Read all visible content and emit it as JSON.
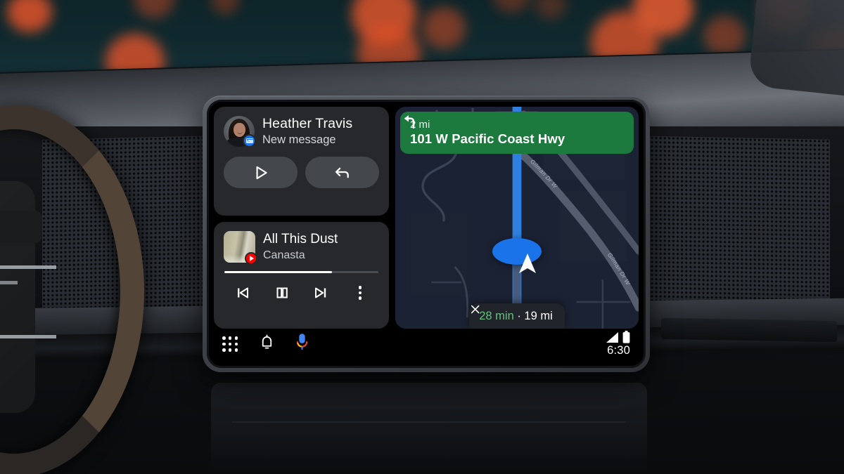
{
  "notification": {
    "sender": "Heather Travis",
    "subtitle": "New message",
    "avatar_icon": "contact-avatar",
    "app_badge_icon": "google-messages-icon",
    "actions": [
      {
        "name": "play-message-button",
        "icon": "play-icon"
      },
      {
        "name": "reply-button",
        "icon": "reply-arrow-icon"
      }
    ]
  },
  "media": {
    "title": "All This Dust",
    "artist": "Canasta",
    "album_art_icon": "album-art",
    "app_badge_icon": "youtube-music-icon",
    "progress_percent": 70,
    "controls": [
      {
        "name": "previous-track-button",
        "icon": "skip-previous-icon"
      },
      {
        "name": "pause-button",
        "icon": "pause-icon"
      },
      {
        "name": "next-track-button",
        "icon": "skip-next-icon"
      },
      {
        "name": "media-overflow-button",
        "icon": "more-vertical-icon"
      }
    ]
  },
  "navigation": {
    "maneuver_icon": "turn-left-icon",
    "distance": "2 mi",
    "road": "101 W Pacific Coast Hwy",
    "banner_color": "#1d7a3e",
    "eta": {
      "close_icon": "close-icon",
      "duration": "28 min",
      "separator": " · ",
      "distance": "19 mi",
      "duration_color": "#64c37d"
    },
    "map": {
      "background_color": "#1b2233",
      "route_color": "#2f7fe0",
      "street_labels": [
        "Gilman Dr W",
        "Gilman Dr W"
      ],
      "position_marker_icon": "navigation-puck-icon"
    }
  },
  "status_bar": {
    "apps_icon": "apps-grid-icon",
    "notifications_icon": "bell-icon",
    "assistant_icon": "google-assistant-mic-icon",
    "signal_icon": "cellular-signal-icon",
    "battery_icon": "battery-full-icon",
    "clock": "6:30"
  }
}
